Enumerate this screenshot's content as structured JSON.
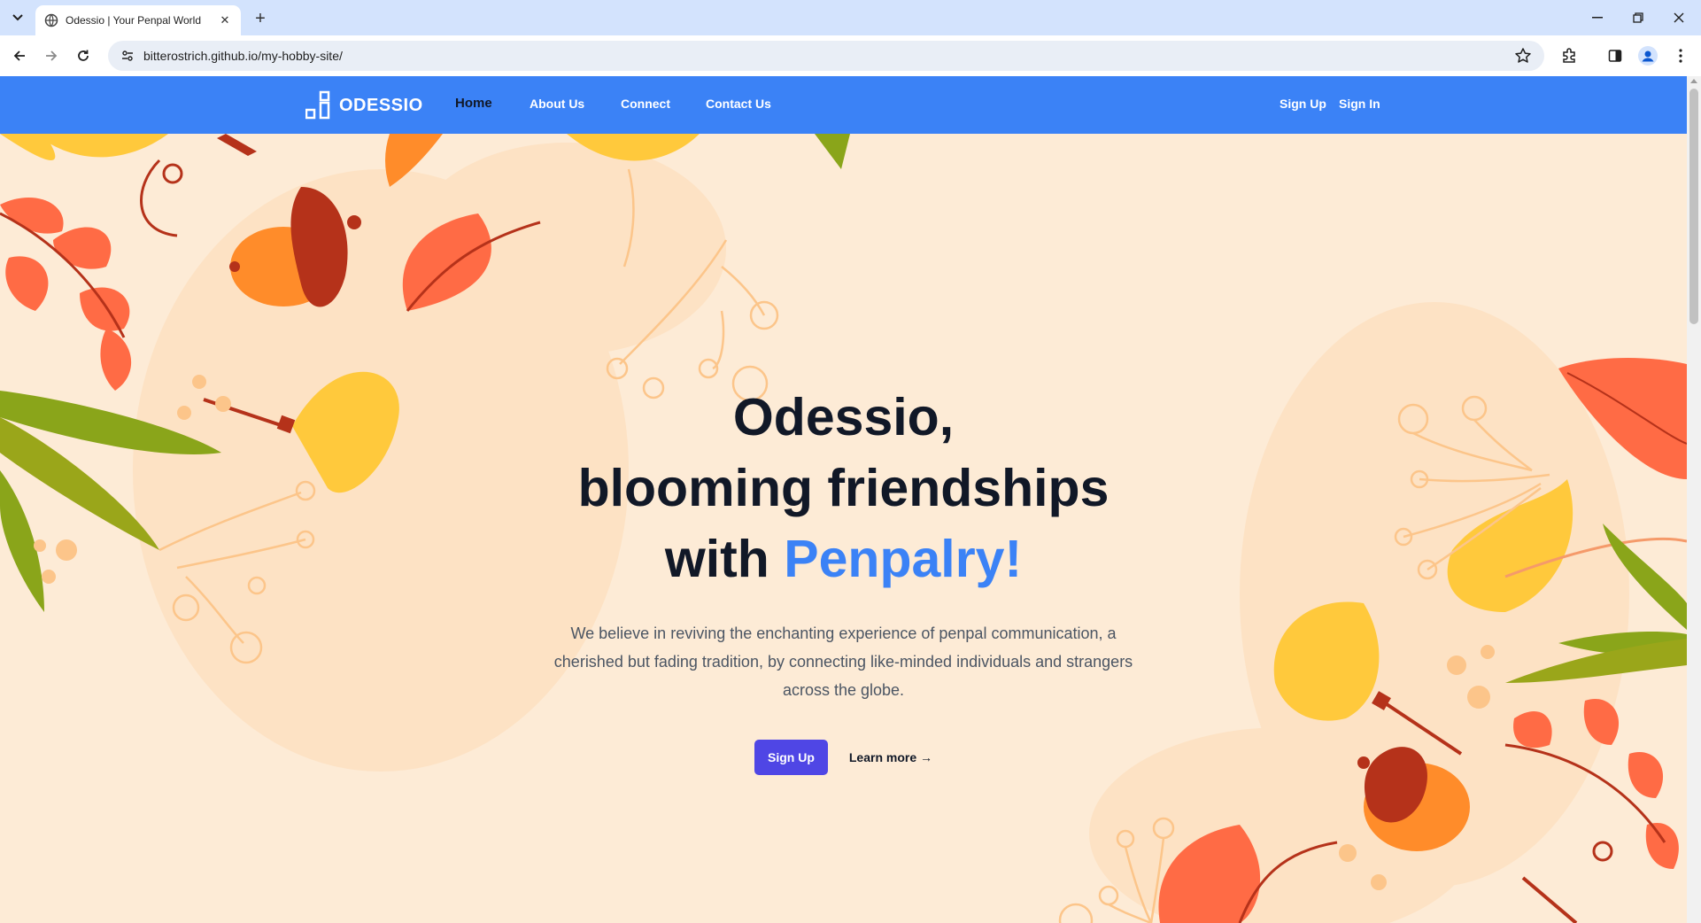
{
  "browser": {
    "tab": {
      "title": "Odessio | Your Penpal World"
    },
    "omnibox": {
      "url": "bitterostrich.github.io/my-hobby-site/"
    },
    "icons": [
      "tab-list-icon",
      "globe-icon",
      "close-icon",
      "plus-icon",
      "minimize-icon",
      "restore-icon",
      "close-window-icon",
      "back-icon",
      "forward-icon",
      "reload-icon",
      "site-info-icon",
      "star-icon",
      "extensions-icon",
      "side-panel-icon",
      "profile-icon",
      "more-icon"
    ]
  },
  "site": {
    "brand": "ODESSIO",
    "nav": {
      "home": "Home",
      "about": "About Us",
      "connect": "Connect",
      "contact": "Contact Us"
    },
    "auth": {
      "signup": "Sign Up",
      "signin": "Sign In"
    },
    "hero": {
      "line1": "Odessio,",
      "line2": "blooming friendships",
      "line3_prefix": "with ",
      "line3_accent": "Penpalry!",
      "description": "We believe in reviving the enchanting experience of penpal communication, a cherished but fading tradition, by connecting like-minded individuals and strangers across the globe.",
      "primary_cta": "Sign Up",
      "secondary_cta": "Learn more →"
    },
    "colors": {
      "nav_bg": "#3b82f6",
      "page_bg": "#fdebd6",
      "accent": "#3b82f6",
      "button": "#4f46e5",
      "leaf_orange": "#ff7043",
      "leaf_yellow": "#ffc93c",
      "leaf_green": "#9aa61a",
      "acorn_brown": "#b5321a"
    }
  }
}
